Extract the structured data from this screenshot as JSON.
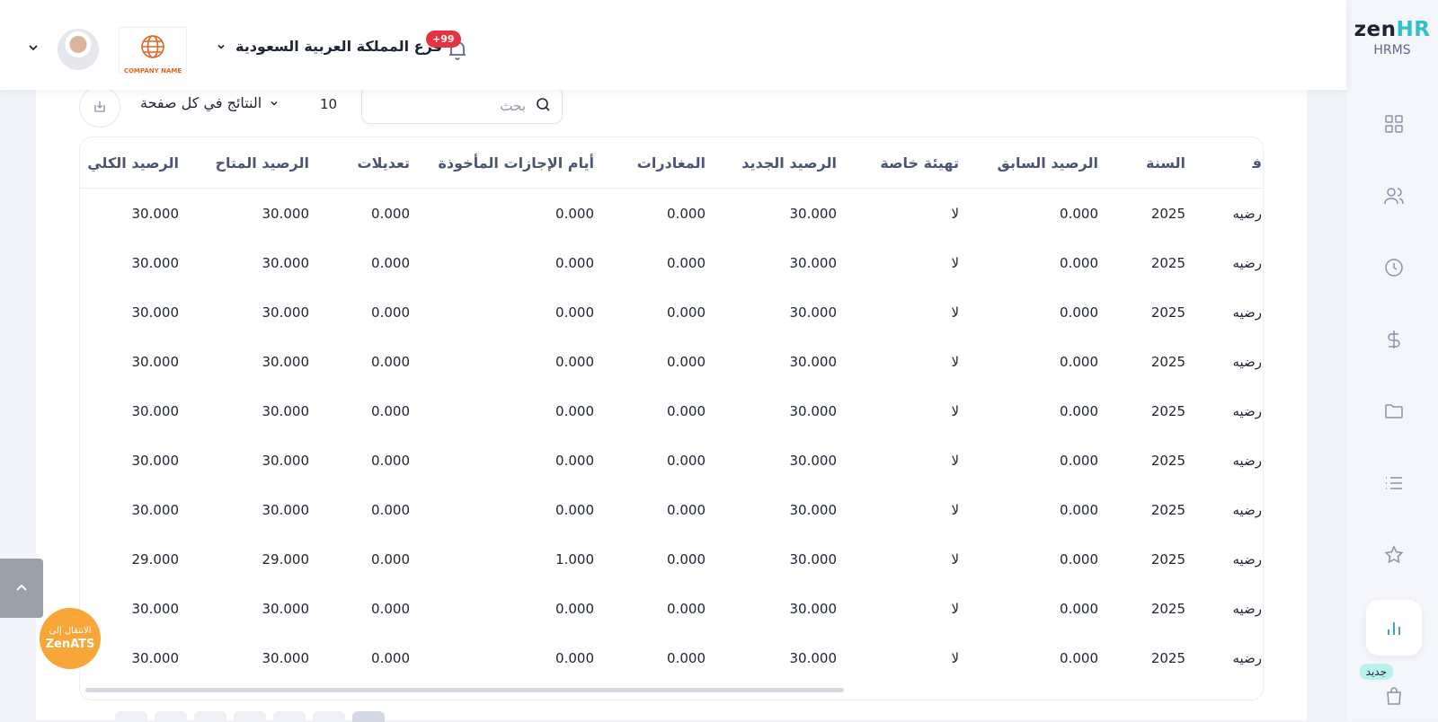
{
  "sidebar": {
    "logo_main": "zen",
    "logo_accent": "HR",
    "product": "HRMS",
    "items": [
      {
        "icon": "grid-icon"
      },
      {
        "icon": "users-icon"
      },
      {
        "icon": "clock-icon"
      },
      {
        "icon": "dollar-icon"
      },
      {
        "icon": "folder-icon"
      },
      {
        "icon": "list-icon"
      },
      {
        "icon": "star-icon"
      },
      {
        "icon": "bar-chart-icon",
        "active": true
      },
      {
        "icon": "shopping-bag-icon"
      }
    ],
    "new_badge": "جديد"
  },
  "header": {
    "branch": "فرع المملكة العربية السعودية",
    "notifications": "+99",
    "company_logo_text": "COMPANY NAME"
  },
  "toolbar": {
    "search_placeholder": "بحث",
    "per_page_value": "10",
    "per_page_label": "النتائج في كل صفحة"
  },
  "table": {
    "columns": [
      "الرصيد الكلي",
      "الرصيد المتاح",
      "تعديلات",
      "أيام الإجازات المأخوذة",
      "المغادرات",
      "الرصيد الجديد",
      "تهيئة خاصة",
      "الرصيد السابق",
      "السنة",
      "ﻓ"
    ],
    "rows": [
      [
        "30.000",
        "30.000",
        "0.000",
        "0.000",
        "0.000",
        "30.000",
        "لا",
        "0.000",
        "2025",
        "رضيه"
      ],
      [
        "30.000",
        "30.000",
        "0.000",
        "0.000",
        "0.000",
        "30.000",
        "لا",
        "0.000",
        "2025",
        "رضيه"
      ],
      [
        "30.000",
        "30.000",
        "0.000",
        "0.000",
        "0.000",
        "30.000",
        "لا",
        "0.000",
        "2025",
        "رضيه"
      ],
      [
        "30.000",
        "30.000",
        "0.000",
        "0.000",
        "0.000",
        "30.000",
        "لا",
        "0.000",
        "2025",
        "رضيه"
      ],
      [
        "30.000",
        "30.000",
        "0.000",
        "0.000",
        "0.000",
        "30.000",
        "لا",
        "0.000",
        "2025",
        "رضيه"
      ],
      [
        "30.000",
        "30.000",
        "0.000",
        "0.000",
        "0.000",
        "30.000",
        "لا",
        "0.000",
        "2025",
        "رضيه"
      ],
      [
        "30.000",
        "30.000",
        "0.000",
        "0.000",
        "0.000",
        "30.000",
        "لا",
        "0.000",
        "2025",
        "رضيه"
      ],
      [
        "29.000",
        "29.000",
        "0.000",
        "1.000",
        "0.000",
        "30.000",
        "لا",
        "0.000",
        "2025",
        "رضيه"
      ],
      [
        "30.000",
        "30.000",
        "0.000",
        "0.000",
        "0.000",
        "30.000",
        "لا",
        "0.000",
        "2025",
        "رضيه"
      ],
      [
        "30.000",
        "30.000",
        "0.000",
        "0.000",
        "0.000",
        "30.000",
        "لا",
        "0.000",
        "2025",
        "رضيه"
      ]
    ]
  },
  "floating": {
    "zenats_line1": "الانتقال إلى",
    "zenats_line2": "ZenATS"
  },
  "colors": {
    "accent": "#2fc1c9",
    "badge": "#e3343f",
    "zenats": "#f8a637",
    "header_text": "#4a5674"
  }
}
